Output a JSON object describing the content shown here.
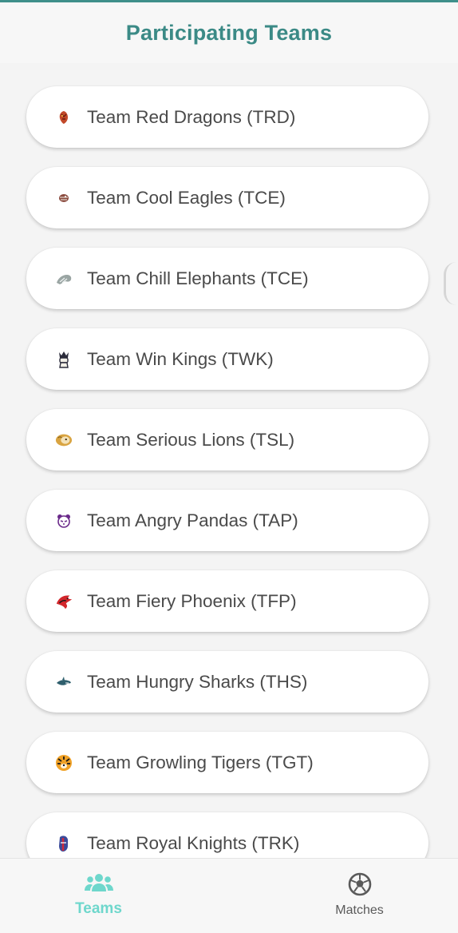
{
  "header": {
    "title": "Participating Teams"
  },
  "teams": [
    {
      "label": "Team Red Dragons (TRD)",
      "icon": "dragon-icon"
    },
    {
      "label": "Team Cool Eagles (TCE)",
      "icon": "eagle-icon"
    },
    {
      "label": "Team Chill Elephants (TCE)",
      "icon": "elephant-icon"
    },
    {
      "label": "Team Win Kings (TWK)",
      "icon": "king-icon"
    },
    {
      "label": "Team Serious Lions (TSL)",
      "icon": "lion-icon"
    },
    {
      "label": "Team Angry Pandas (TAP)",
      "icon": "panda-icon"
    },
    {
      "label": "Team Fiery Phoenix (TFP)",
      "icon": "phoenix-icon"
    },
    {
      "label": "Team Hungry Sharks (THS)",
      "icon": "shark-icon"
    },
    {
      "label": "Team Growling Tigers (TGT)",
      "icon": "tiger-icon"
    },
    {
      "label": "Team Royal Knights (TRK)",
      "icon": "knight-icon"
    }
  ],
  "bottom_nav": {
    "tabs": [
      {
        "label": "Teams",
        "icon": "people-icon",
        "active": true
      },
      {
        "label": "Matches",
        "icon": "soccer-ball-icon",
        "active": false
      }
    ]
  },
  "colors": {
    "accent": "#3b8a86",
    "active_tab": "#6ed7cc",
    "card_bg": "#ffffff",
    "page_bg": "#f4f4f4"
  }
}
